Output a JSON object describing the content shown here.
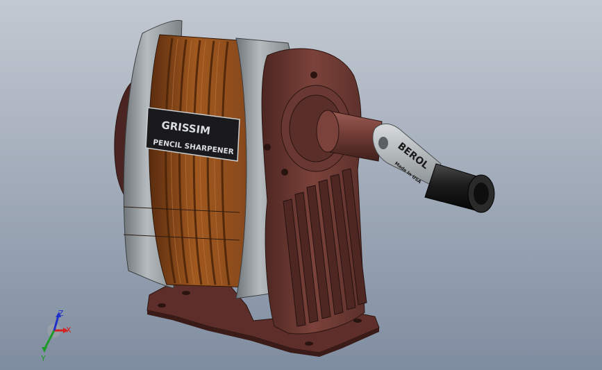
{
  "viewport": {
    "background_top": "#c3c9d2",
    "background_bottom": "#7f8da0"
  },
  "model": {
    "body_label_line1": "GRISSIM",
    "body_label_line2": "PENCIL SHARPENER",
    "crank_label_brand": "BEROL",
    "crank_label_origin": "Made In USA",
    "colors": {
      "copper": "#8a4a1c",
      "gray_band": "#9ba1a4",
      "housing": "#6e3a33",
      "crank": "#b6bbbe",
      "handle": "#1a1a1a"
    }
  },
  "triad": {
    "x_label": "X",
    "y_label": "Y",
    "z_label": "Z",
    "x_color": "#d42020",
    "y_color": "#1d9a2a",
    "z_color": "#2030c8"
  }
}
